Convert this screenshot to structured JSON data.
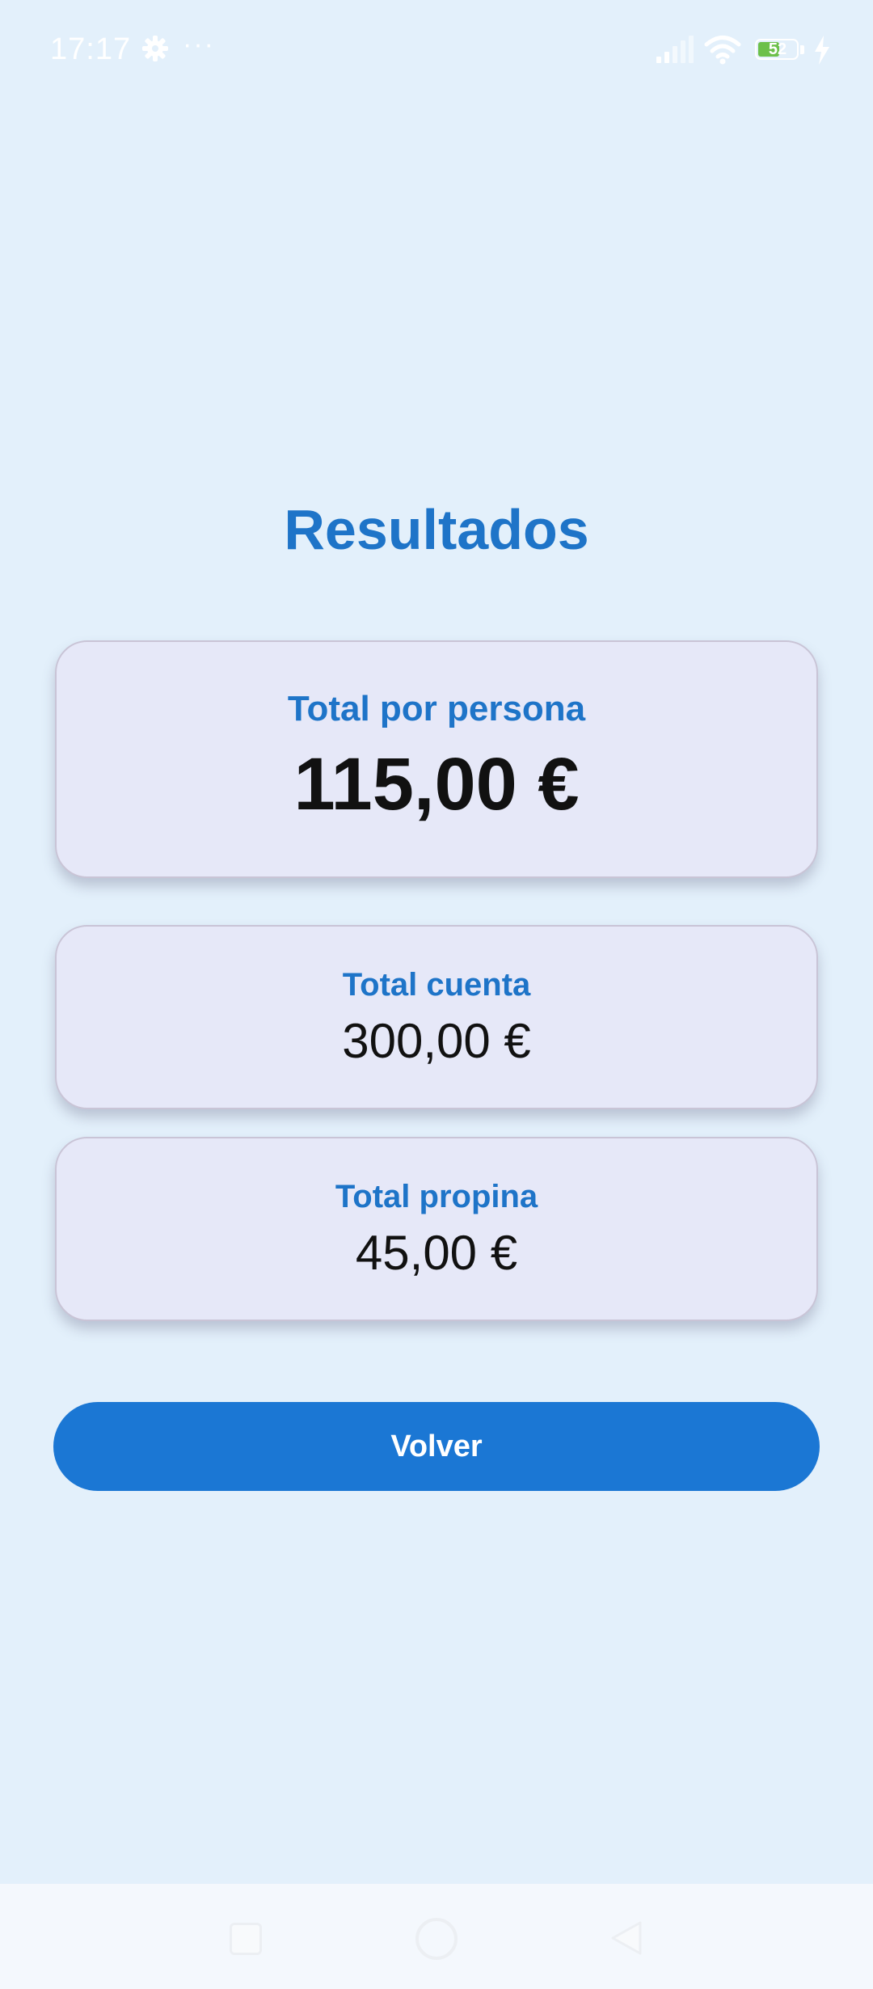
{
  "status_bar": {
    "time": "17:17",
    "dots": "···",
    "battery_level": "52",
    "icons": [
      "gear-icon",
      "signal-icon",
      "wifi-icon",
      "battery-icon",
      "charging-icon"
    ]
  },
  "results": {
    "title": "Resultados",
    "per_person": {
      "label": "Total por persona",
      "value": "115,00 €"
    },
    "total_bill": {
      "label": "Total cuenta",
      "value": "300,00 €"
    },
    "total_tip": {
      "label": "Total propina",
      "value": "45,00 €"
    }
  },
  "actions": {
    "back_label": "Volver"
  },
  "nav": {
    "icons": [
      "recent-apps-icon",
      "home-icon",
      "back-icon"
    ]
  },
  "colors": {
    "background": "#e3f0fb",
    "accent": "#1e74c8",
    "button": "#1b77d4",
    "card": "#e6e8f8"
  }
}
